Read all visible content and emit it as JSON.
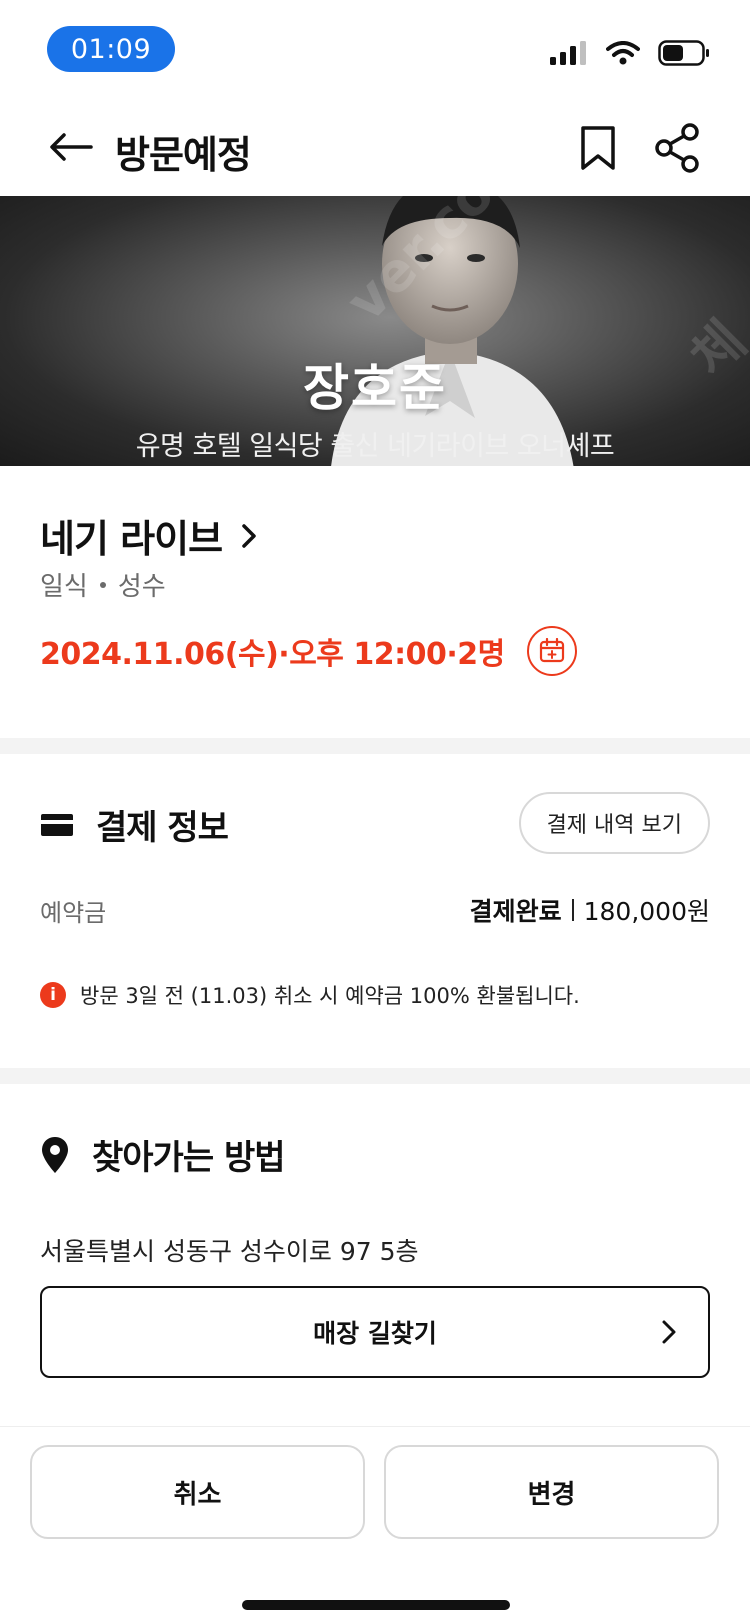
{
  "status_bar": {
    "time": "01:09"
  },
  "header": {
    "title": "방문예정"
  },
  "hero": {
    "chef_name": "장호준",
    "subtitle": "유명 호텔 일식당 출신 네기라이브 오너셰프"
  },
  "restaurant": {
    "name": "네기 라이브",
    "cuisine": "일식",
    "area": "성수",
    "visit_info": "2024.11.06(수)·오후 12:00·2명"
  },
  "payment": {
    "title": "결제 정보",
    "history_button": "결제 내역 보기",
    "deposit_label": "예약금",
    "status": "결제완료",
    "amount": "180,000원",
    "notice": "방문 3일 전 (11.03) 취소 시 예약금 100% 환불됩니다."
  },
  "directions": {
    "title": "찾아가는 방법",
    "address": "서울특별시 성동구 성수이로 97 5층",
    "route_button": "매장 길찾기"
  },
  "actions": {
    "cancel": "취소",
    "change": "변경"
  },
  "colors": {
    "accent": "#ec3a1c",
    "time_pill": "#1a73e8",
    "divider": "#f3f3f3"
  },
  "icons": [
    "back-arrow-icon",
    "bookmark-icon",
    "share-icon",
    "chevron-right-icon",
    "calendar-icon",
    "card-icon",
    "info-icon",
    "location-pin-icon"
  ]
}
